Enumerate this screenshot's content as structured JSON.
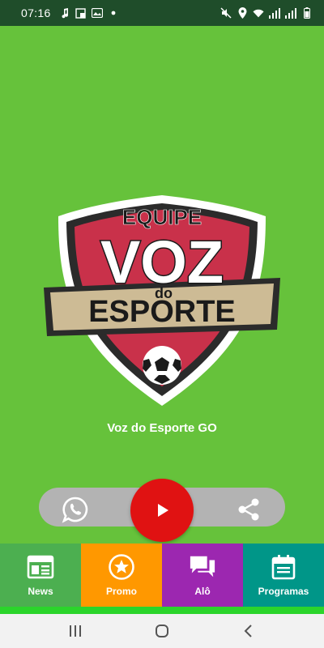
{
  "status_bar": {
    "time": "07:16",
    "left_icons": [
      "music-note-icon",
      "screenshot-icon",
      "gallery-icon",
      "notification-dot-icon"
    ],
    "right_icons": [
      "mute-icon",
      "location-icon",
      "wifi-icon",
      "signal-icon",
      "signal-icon",
      "battery-icon"
    ]
  },
  "logo": {
    "line1": "EQUIPE",
    "line2": "VOZ",
    "line3": "do",
    "line4": "ESPORTE"
  },
  "station": {
    "title": "Voz do Esporte GO"
  },
  "actions": {
    "whatsapp_icon": "whatsapp-icon",
    "play_icon": "play-icon",
    "share_icon": "share-icon"
  },
  "bottom_nav": {
    "tabs": [
      {
        "label": "News",
        "icon": "news-icon",
        "color": "#4caf50"
      },
      {
        "label": "Promo",
        "icon": "star-icon",
        "color": "#ff9800"
      },
      {
        "label": "Alô",
        "icon": "chat-icon",
        "color": "#9c27b0"
      },
      {
        "label": "Programas",
        "icon": "calendar-icon",
        "color": "#009688"
      }
    ]
  },
  "system_nav": {
    "buttons": [
      "recent-apps-icon",
      "home-icon",
      "back-icon"
    ]
  },
  "colors": {
    "background": "#66c23b",
    "status_bar": "#1f4d2a",
    "play_button": "#e01212",
    "pill": "#b3b3b3",
    "shield_red": "#c9314a",
    "shield_dark": "#2b2b2b",
    "banner": "#cdbb95"
  }
}
